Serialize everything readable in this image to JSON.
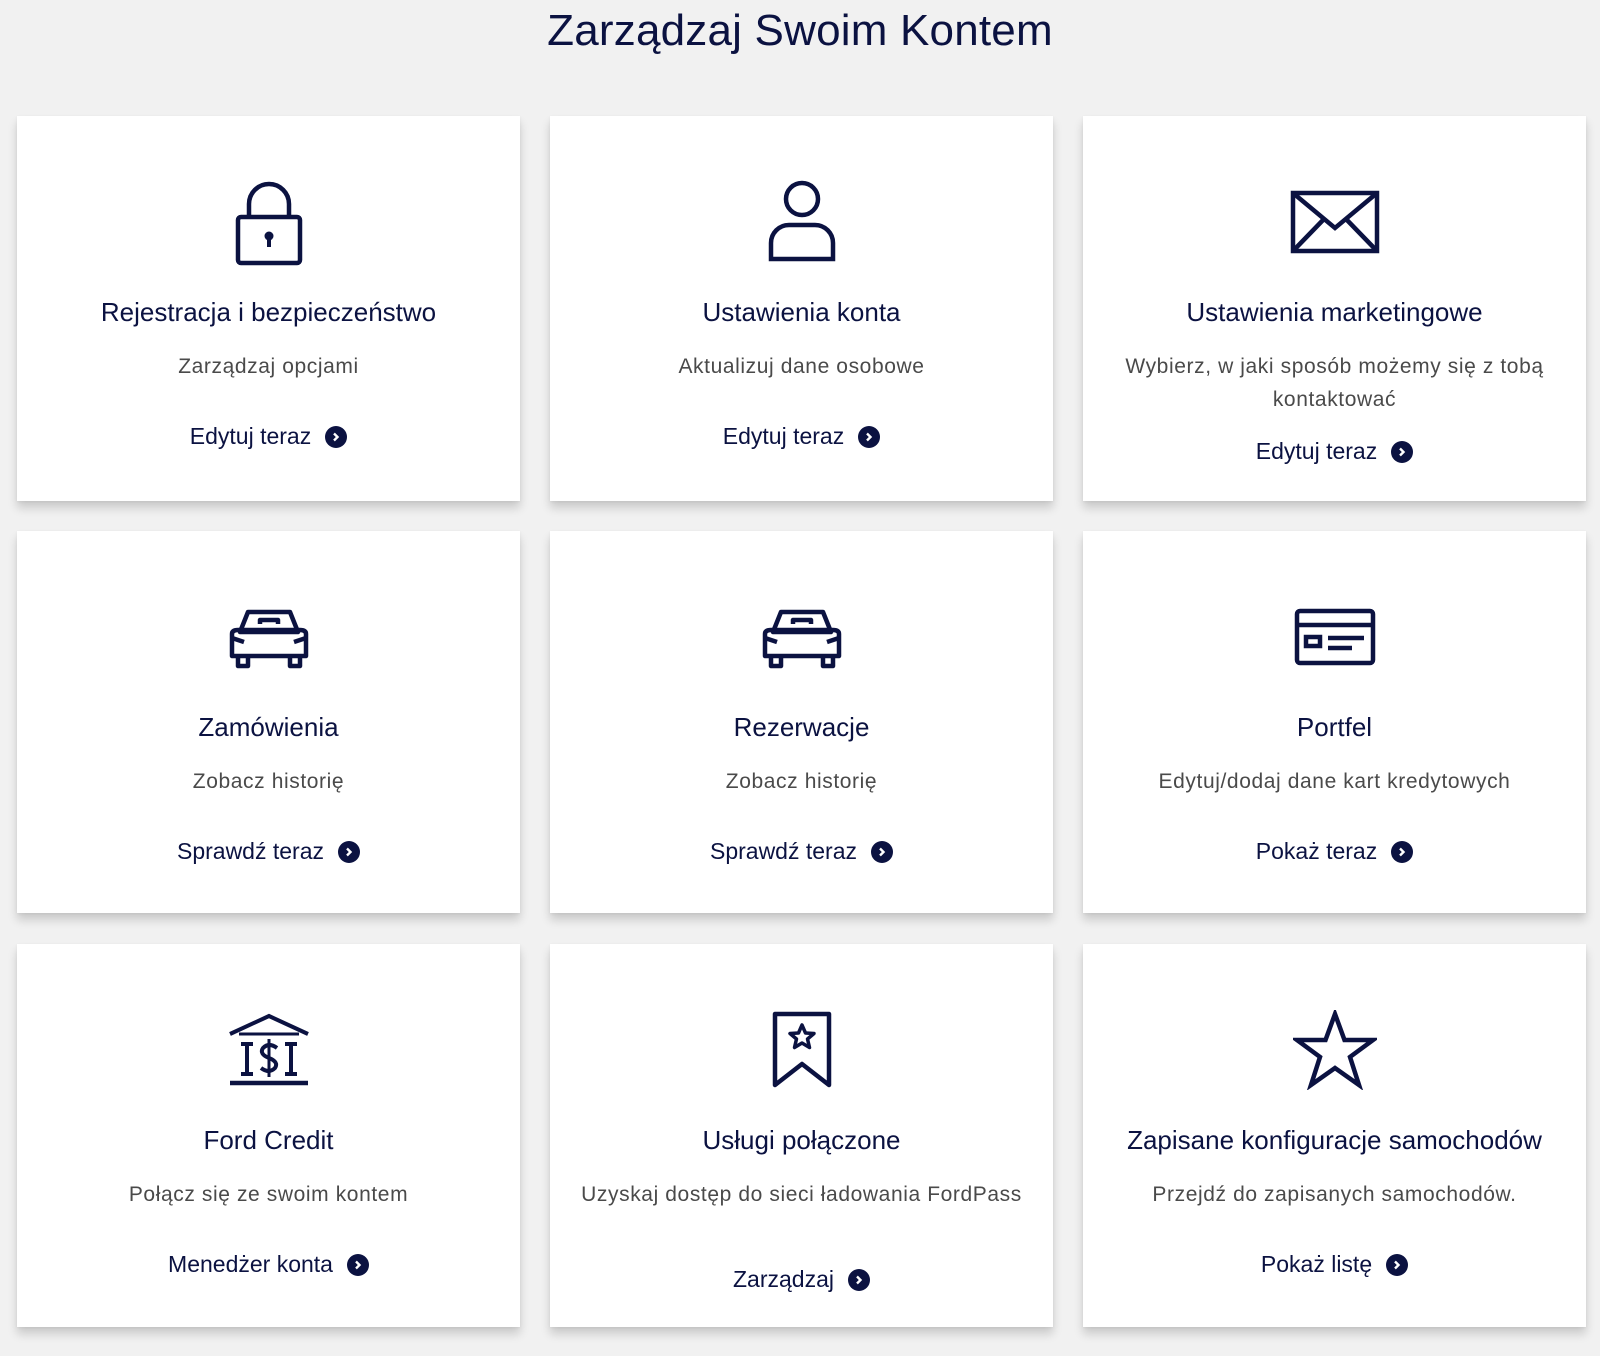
{
  "page": {
    "title": "Zarządzaj Swoim Kontem"
  },
  "colors": {
    "primary": "#0b1241",
    "text_secondary": "#4a4a4a",
    "background": "#f1f1f1",
    "card": "#ffffff"
  },
  "cards": [
    {
      "icon": "lock-icon",
      "title": "Rejestracja i bezpieczeństwo",
      "description": "Zarządzaj opcjami",
      "link": "Edytuj teraz"
    },
    {
      "icon": "user-icon",
      "title": "Ustawienia konta",
      "description": "Aktualizuj dane osobowe",
      "link": "Edytuj teraz"
    },
    {
      "icon": "envelope-icon",
      "title": "Ustawienia marketingowe",
      "description": "Wybierz, w jaki sposób możemy się z tobą kontaktować",
      "link": "Edytuj teraz"
    },
    {
      "icon": "car-icon",
      "title": "Zamówienia",
      "description": "Zobacz historię",
      "link": "Sprawdź teraz"
    },
    {
      "icon": "car-icon",
      "title": "Rezerwacje",
      "description": "Zobacz historię",
      "link": "Sprawdź teraz"
    },
    {
      "icon": "credit-card-icon",
      "title": "Portfel",
      "description": "Edytuj/dodaj dane kart kredytowych",
      "link": "Pokaż teraz"
    },
    {
      "icon": "bank-icon",
      "title": "Ford Credit",
      "description": "Połącz się ze swoim kontem",
      "link": "Menedżer konta"
    },
    {
      "icon": "bookmark-star-icon",
      "title": "Usługi połączone",
      "description": "Uzyskaj dostęp do sieci ładowania FordPass",
      "link": "Zarządzaj"
    },
    {
      "icon": "star-icon",
      "title": "Zapisane konfiguracje samochodów",
      "description": "Przejdź do zapisanych samochodów.",
      "link": "Pokaż listę"
    }
  ]
}
